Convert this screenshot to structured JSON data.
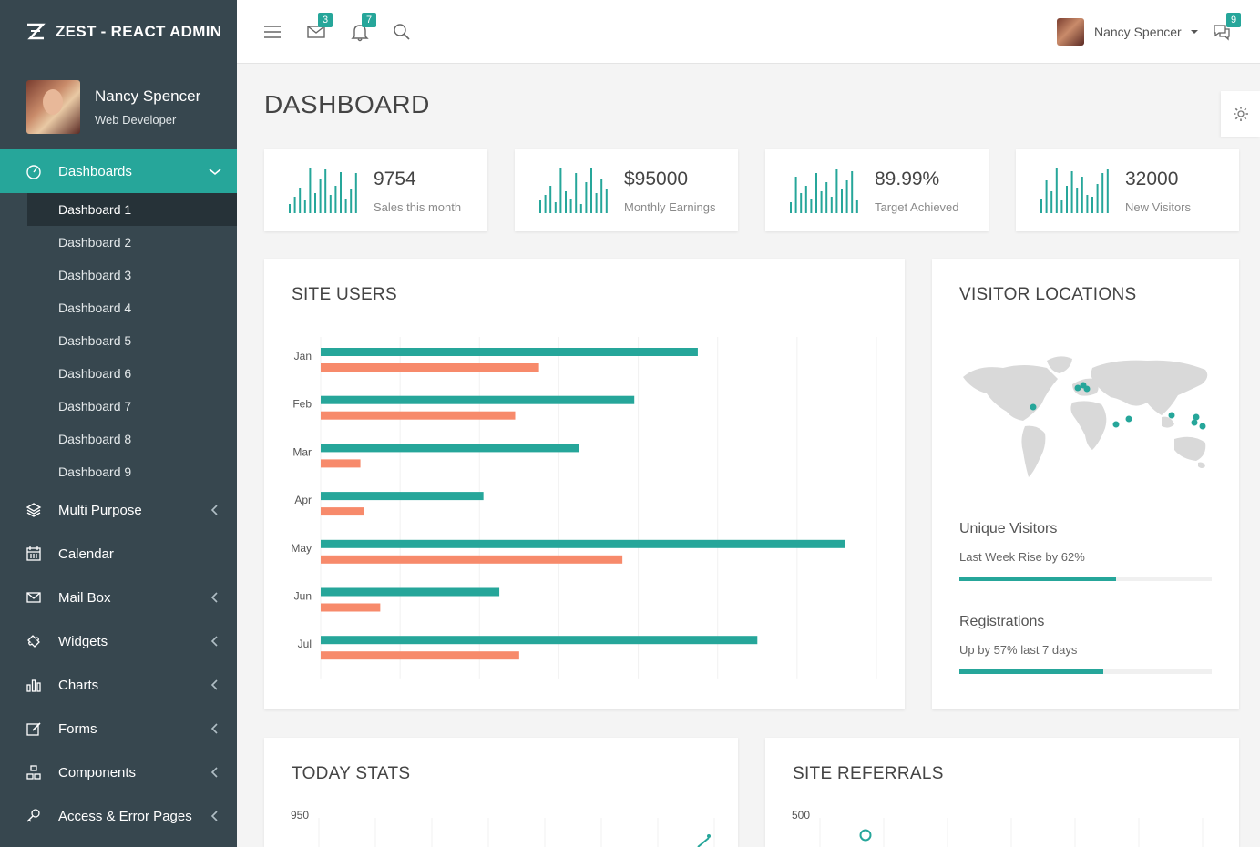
{
  "app": {
    "brand": "ZEST - REACT ADMIN"
  },
  "profile": {
    "name": "Nancy Spencer",
    "role": "Web Developer"
  },
  "sidebar": {
    "dashboards_label": "Dashboards",
    "sub_items": [
      "Dashboard 1",
      "Dashboard 2",
      "Dashboard 3",
      "Dashboard 4",
      "Dashboard 5",
      "Dashboard 6",
      "Dashboard 7",
      "Dashboard 8",
      "Dashboard 9"
    ],
    "items": [
      {
        "label": "Multi Purpose",
        "icon": "layers-icon",
        "has_children": true
      },
      {
        "label": "Calendar",
        "icon": "calendar-icon",
        "has_children": false
      },
      {
        "label": "Mail Box",
        "icon": "envelope-icon",
        "has_children": true
      },
      {
        "label": "Widgets",
        "icon": "puzzle-icon",
        "has_children": true
      },
      {
        "label": "Charts",
        "icon": "bar-chart-icon",
        "has_children": true
      },
      {
        "label": "Forms",
        "icon": "edit-icon",
        "has_children": true
      },
      {
        "label": "Components",
        "icon": "components-icon",
        "has_children": true
      },
      {
        "label": "Access & Error Pages",
        "icon": "key-icon",
        "has_children": true
      }
    ]
  },
  "topbar": {
    "mail_count": "3",
    "notification_count": "7",
    "user_name": "Nancy Spencer",
    "chat_count": "9"
  },
  "page": {
    "title": "DASHBOARD"
  },
  "stats": [
    {
      "value": "9754",
      "label": "Sales this month"
    },
    {
      "value": "$95000",
      "label": "Monthly Earnings"
    },
    {
      "value": "89.99%",
      "label": "Target Achieved"
    },
    {
      "value": "32000",
      "label": "New Visitors"
    }
  ],
  "site_users": {
    "title": "SITE USERS"
  },
  "visitor_locations": {
    "title": "VISITOR LOCATIONS",
    "unique_title": "Unique Visitors",
    "unique_sub": "Last Week Rise by 62%",
    "unique_progress": 0.62,
    "reg_title": "Registrations",
    "reg_sub": "Up by 57% last 7 days",
    "reg_progress": 0.57
  },
  "today_stats": {
    "title": "TODAY STATS",
    "y_top_tick": "950"
  },
  "site_referrals": {
    "title": "SITE REFERRALS",
    "y_top_tick": "500"
  },
  "colors": {
    "accent": "#26a69a",
    "secondary": "#f78a6b",
    "sidebar": "#37474f"
  },
  "chart_data": {
    "type": "bar",
    "orientation": "horizontal",
    "categories": [
      "Jan",
      "Feb",
      "Mar",
      "Apr",
      "May",
      "Jun",
      "Jul"
    ],
    "series": [
      {
        "values": [
          95,
          79,
          65,
          41,
          132,
          45,
          110
        ]
      },
      {
        "values": [
          55,
          49,
          10,
          11,
          76,
          15,
          50
        ]
      }
    ],
    "xlim": [
      0,
      140
    ],
    "grid": true
  }
}
